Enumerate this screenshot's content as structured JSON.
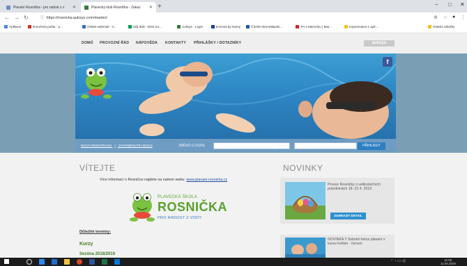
{
  "browser": {
    "tabs": [
      {
        "label": "Plavání Rosnička - pro radost z v"
      },
      {
        "label": "Plavecký klub Rosnička - Zakaz"
      }
    ],
    "new_tab": "+",
    "window": {
      "minimize": "−",
      "maximize": "□",
      "close": "✕"
    },
    "url": "https://rosnicka.auksys.com/master/",
    "bookmarks": [
      {
        "label": "Aplikace",
        "color": "#4f86ec"
      },
      {
        "label": "Doručená pošta - p...",
        "color": "#d93025"
      },
      {
        "label": "ONdet webmail - V...",
        "color": "#2f72c4"
      },
      {
        "label": "Můj disk - Disk Go...",
        "color": "#0f9d58"
      },
      {
        "label": "Auksys - Login",
        "color": "#3a7a3a"
      },
      {
        "label": "Eurovia by Darny",
        "color": "#1b3f8f"
      },
      {
        "label": "ČSOB InternetBanki...",
        "color": "#1d5aa8"
      },
      {
        "label": "TH s Marcelou | Mar...",
        "color": "#d2252e"
      },
      {
        "label": "Importováno z apli...",
        "color": "#f2c21b"
      },
      {
        "label": "Ostatní záložky",
        "color": "#f2c21b"
      }
    ]
  },
  "site": {
    "nav": [
      "DOMŮ",
      "PROVOZNÍ ŘÁD",
      "NÁPOVĚDA",
      "KONTAKTY",
      "PŘIHLÁŠKY / DOTAZNÍKY"
    ],
    "brand": "auksys",
    "facebook": "f",
    "login": {
      "new_registration": "NOVÁ REGISTRACE",
      "separator": "|",
      "forgot_password": "ZAPOMENUTÉ HESLO",
      "username_label": "JMÉNO (LOGIN)",
      "password_label": "HESLO",
      "submit": "PŘIHLÁSIT"
    },
    "welcome": {
      "title": "VÍTEJTE",
      "intro": "Více informací o Rosničce najdete na našem webu:",
      "link": "www.plavani-rosnicka.cz",
      "logo_sub": "PLAVECKÁ ŠKOLA",
      "logo_main": "ROSNIČKA",
      "logo_tag": "PRO RADOST Z VODY",
      "terms": "Důležité termíny:",
      "courses": "Kurzy",
      "season": "Sezóna 2018/2019"
    },
    "news": {
      "title": "NOVINKY",
      "items": [
        {
          "text": "Provoz Rosničky o velikonočních prázdninách 18.-22.4. 2019",
          "button": "ZOBRAZIT DETAIL"
        },
        {
          "text": "NOVINKA !! Sobotní lekce plavání v kurzu květen - červen",
          "button": ""
        }
      ]
    }
  },
  "taskbar": {
    "time": "11:06",
    "date": "11.04.2019"
  }
}
